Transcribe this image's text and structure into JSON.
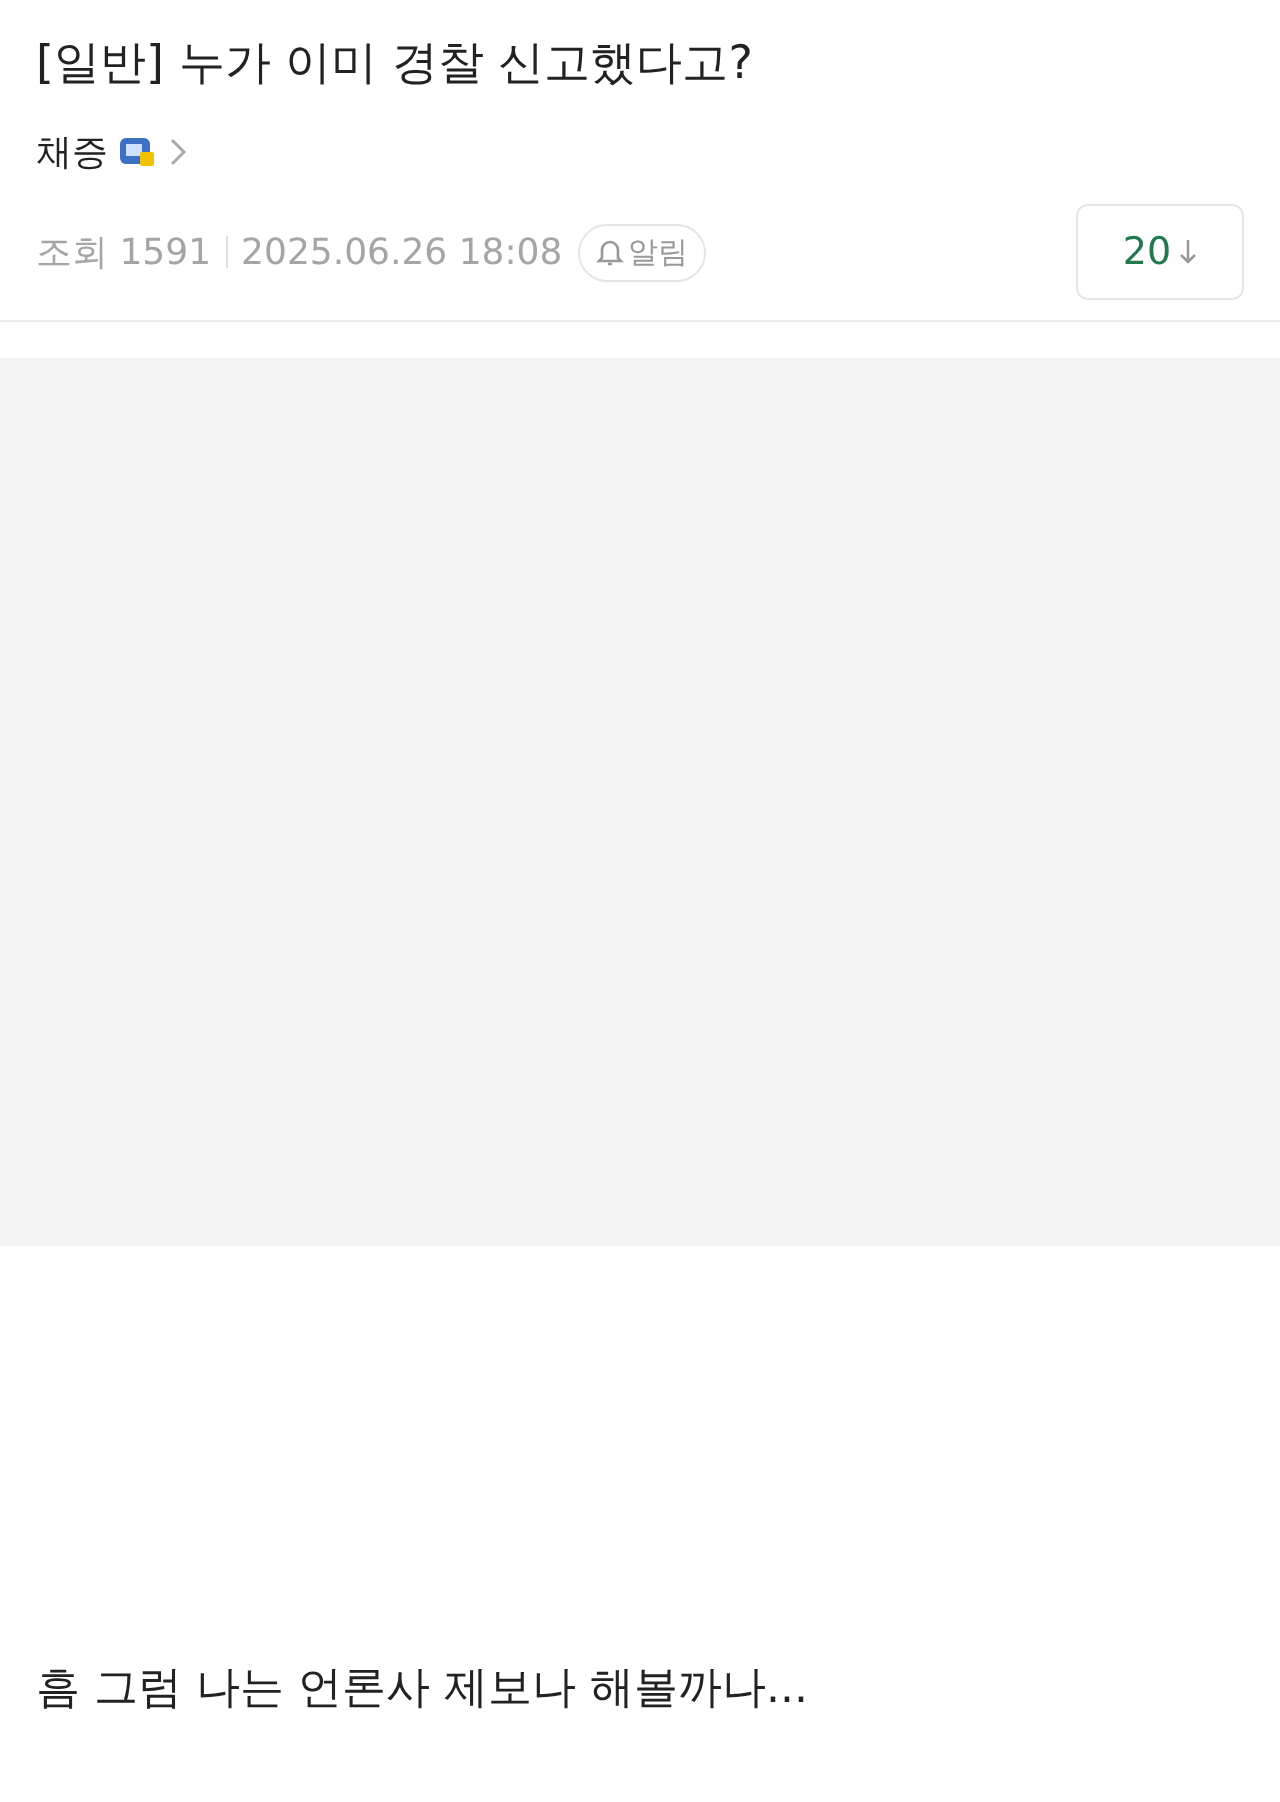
{
  "post": {
    "category": "[일반]",
    "title": "누가 이미 경찰 신고했다고?",
    "author": "채증",
    "views_label": "조회",
    "views": "1591",
    "date": "2025.06.26 18:08",
    "notify": "알림",
    "comments": "20"
  },
  "body": {
    "image": {
      "kind": "placeholder"
    },
    "text": "흠 그럼 나는 언론사 제보나 해볼까나..."
  }
}
